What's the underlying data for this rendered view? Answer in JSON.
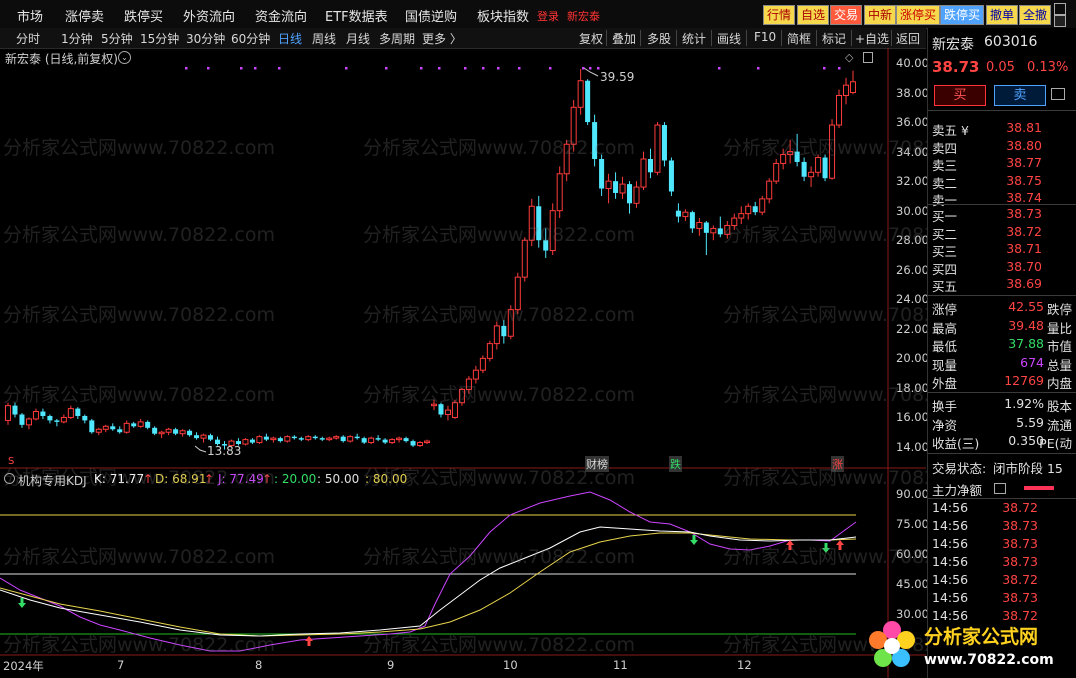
{
  "menu": {
    "items": [
      "市场",
      "涨停卖",
      "跌停买",
      "外资流向",
      "资金流向",
      "ETF数据表",
      "国债逆购",
      "板块指数"
    ],
    "red_items": [
      "登录",
      "新宏泰"
    ],
    "buttons": [
      "行情",
      "自选",
      "交易",
      "中新",
      "涨停买",
      "跌停买",
      "撤单",
      "全撤"
    ],
    "win_icons": [
      "restore-icon",
      "close-icon"
    ]
  },
  "periods": [
    "分时",
    "1分钟",
    "5分钟",
    "15分钟",
    "30分钟",
    "60分钟",
    "日线",
    "周线",
    "月线",
    "多周期",
    "更多 〉"
  ],
  "active_period": "日线",
  "tools": [
    "复权",
    "叠加",
    "多股",
    "统计",
    "画线",
    "F10",
    "简框",
    "标记",
    "+自选",
    "返回"
  ],
  "chart_title": "新宏泰 (日线,前复权)",
  "kdj": {
    "name": "机构专用KDJ",
    "k": "K: 71.77",
    "d": "D: 68.91",
    "j": "J: 77.49",
    "l1": ": 20.00",
    "l2": ": 50.00",
    "l3": ": 80.00",
    "up_arrow": "↑"
  },
  "annotations": {
    "high": "39.59",
    "low": "13.83"
  },
  "event_labels": [
    "S",
    "财榜",
    "跌",
    "涨"
  ],
  "price_axis": [
    "40.00",
    "38.00",
    "36.00",
    "34.00",
    "32.00",
    "30.00",
    "28.00",
    "26.00",
    "24.00",
    "22.00",
    "20.00",
    "18.00",
    "16.00",
    "14.00"
  ],
  "kdj_axis": [
    "90.00",
    "75.00",
    "60.00",
    "45.00",
    "30.00"
  ],
  "x_axis": [
    "2024年",
    "7",
    "8",
    "9",
    "10",
    "11",
    "12"
  ],
  "colors": {
    "up": "#ff3b3b",
    "down": "#4fe8ff",
    "k": "#ffffff",
    "d": "#e8d44d",
    "j": "#cc44ff",
    "line20": "#22bb22",
    "line50": "#e0e0e0",
    "line80": "#e8d44d"
  },
  "quote": {
    "name": "新宏泰",
    "code": "603016",
    "price": "38.73",
    "change": "0.05",
    "pct": "0.13%",
    "buy_btn": "买",
    "sell_btn": "卖",
    "ask": [
      {
        "label": "卖五 ¥",
        "price": "38.81"
      },
      {
        "label": "卖四",
        "price": "38.80"
      },
      {
        "label": "卖三",
        "price": "38.77"
      },
      {
        "label": "卖二",
        "price": "38.75"
      },
      {
        "label": "卖一",
        "price": "38.74"
      }
    ],
    "bid": [
      {
        "label": "买一",
        "price": "38.73"
      },
      {
        "label": "买二",
        "price": "38.72"
      },
      {
        "label": "买三",
        "price": "38.71"
      },
      {
        "label": "买四",
        "price": "38.70"
      },
      {
        "label": "买五",
        "price": "38.69"
      }
    ],
    "stats": [
      {
        "label": "涨停",
        "value": "42.55",
        "extra": "跌停",
        "color": "red"
      },
      {
        "label": "最高",
        "value": "39.48",
        "extra": "量比",
        "color": "red"
      },
      {
        "label": "最低",
        "value": "37.88",
        "extra": "市值",
        "color": "green"
      },
      {
        "label": "现量",
        "value": "674",
        "extra": "总量",
        "color": "mag"
      },
      {
        "label": "外盘",
        "value": "12769",
        "extra": "内盘",
        "color": "red"
      }
    ],
    "stats2": [
      {
        "label": "换手",
        "value": "1.92%",
        "extra": "股本"
      },
      {
        "label": "净资",
        "value": "5.59",
        "extra": "流通"
      },
      {
        "label": "收益(三)",
        "value": "0.350",
        "extra": "PE(动"
      }
    ],
    "trade_status_label": "交易状态:",
    "trade_status": "闭市阶段 15",
    "main_flow": "主力净额",
    "ticks": [
      {
        "t": "14:56",
        "p": "38.72"
      },
      {
        "t": "14:56",
        "p": "38.73"
      },
      {
        "t": "14:56",
        "p": "38.73"
      },
      {
        "t": "14:56",
        "p": "38.73"
      },
      {
        "t": "14:56",
        "p": "38.72"
      },
      {
        "t": "14:56",
        "p": "38.73"
      },
      {
        "t": "14:56",
        "p": "38.72"
      }
    ]
  },
  "logo": {
    "title": "分析家公式网",
    "url": "www.70822.com"
  },
  "watermark": "分析家公式网www.70822.com",
  "chart_data": {
    "type": "candlestick",
    "title": "新宏泰 (日线,前复权)",
    "ylim": [
      13,
      40.5
    ],
    "y_ticks": [
      14,
      16,
      18,
      20,
      22,
      24,
      26,
      28,
      30,
      32,
      34,
      36,
      38,
      40
    ],
    "x_ticks": [
      "2024年",
      "7",
      "8",
      "9",
      "10",
      "11",
      "12"
    ],
    "candles": [
      [
        15.8,
        17.0,
        15.5,
        16.8
      ],
      [
        16.8,
        17.0,
        16.0,
        16.2
      ],
      [
        16.2,
        16.3,
        15.3,
        15.5
      ],
      [
        15.5,
        16.0,
        15.2,
        15.9
      ],
      [
        15.9,
        16.6,
        15.8,
        16.4
      ],
      [
        16.4,
        16.6,
        15.9,
        16.1
      ],
      [
        16.1,
        16.2,
        15.6,
        15.8
      ],
      [
        15.8,
        15.9,
        15.4,
        15.7
      ],
      [
        15.7,
        16.2,
        15.6,
        16.0
      ],
      [
        16.0,
        16.8,
        15.9,
        16.6
      ],
      [
        16.6,
        16.7,
        15.9,
        16.1
      ],
      [
        16.1,
        16.2,
        15.6,
        15.8
      ],
      [
        15.8,
        15.9,
        14.9,
        15.0
      ],
      [
        15.0,
        15.3,
        14.8,
        15.2
      ],
      [
        15.2,
        15.5,
        15.0,
        15.4
      ],
      [
        15.4,
        15.6,
        15.1,
        15.2
      ],
      [
        15.2,
        15.4,
        14.9,
        15.0
      ],
      [
        15.0,
        15.8,
        14.9,
        15.6
      ],
      [
        15.6,
        15.7,
        15.3,
        15.4
      ],
      [
        15.4,
        15.9,
        15.3,
        15.7
      ],
      [
        15.7,
        15.8,
        15.2,
        15.3
      ],
      [
        15.3,
        15.4,
        14.8,
        14.9
      ],
      [
        14.9,
        15.1,
        14.6,
        15.0
      ],
      [
        15.0,
        15.3,
        14.8,
        15.2
      ],
      [
        15.2,
        15.3,
        14.8,
        14.9
      ],
      [
        14.9,
        15.2,
        14.7,
        15.1
      ],
      [
        15.1,
        15.2,
        14.7,
        14.8
      ],
      [
        14.8,
        15.0,
        14.5,
        14.6
      ],
      [
        14.6,
        14.9,
        14.3,
        14.8
      ],
      [
        14.8,
        14.9,
        14.4,
        14.5
      ],
      [
        14.5,
        14.7,
        14.1,
        14.2
      ],
      [
        14.2,
        14.4,
        13.83,
        14.1
      ],
      [
        14.1,
        14.5,
        14.0,
        14.4
      ],
      [
        14.4,
        14.6,
        14.1,
        14.2
      ],
      [
        14.2,
        14.6,
        14.1,
        14.5
      ],
      [
        14.5,
        14.6,
        14.2,
        14.3
      ],
      [
        14.3,
        14.8,
        14.2,
        14.7
      ],
      [
        14.7,
        14.9,
        14.4,
        14.5
      ],
      [
        14.5,
        14.7,
        14.3,
        14.6
      ],
      [
        14.6,
        14.7,
        14.3,
        14.4
      ],
      [
        14.4,
        14.8,
        14.3,
        14.7
      ],
      [
        14.7,
        14.8,
        14.5,
        14.6
      ],
      [
        14.6,
        14.7,
        14.4,
        14.5
      ],
      [
        14.5,
        14.8,
        14.4,
        14.7
      ],
      [
        14.7,
        14.8,
        14.5,
        14.6
      ],
      [
        14.6,
        14.7,
        14.4,
        14.5
      ],
      [
        14.5,
        14.7,
        14.4,
        14.6
      ],
      [
        14.6,
        14.8,
        14.5,
        14.7
      ],
      [
        14.7,
        14.8,
        14.3,
        14.4
      ],
      [
        14.4,
        14.8,
        14.3,
        14.7
      ],
      [
        14.7,
        14.9,
        14.5,
        14.6
      ],
      [
        14.6,
        14.7,
        14.2,
        14.3
      ],
      [
        14.3,
        14.7,
        14.2,
        14.6
      ],
      [
        14.6,
        14.8,
        14.4,
        14.5
      ],
      [
        14.5,
        14.6,
        14.2,
        14.3
      ],
      [
        14.3,
        14.6,
        14.2,
        14.5
      ],
      [
        14.5,
        14.7,
        14.3,
        14.6
      ],
      [
        14.6,
        14.7,
        14.3,
        14.4
      ],
      [
        14.4,
        14.5,
        14.0,
        14.1
      ],
      [
        14.1,
        14.4,
        14.0,
        14.3
      ],
      [
        14.3,
        14.5,
        14.2,
        14.4
      ],
      [
        16.8,
        17.2,
        16.5,
        16.9
      ],
      [
        16.9,
        17.0,
        16.0,
        16.2
      ],
      [
        16.2,
        16.8,
        15.8,
        16.5
      ],
      [
        16.0,
        17.2,
        15.9,
        17.0
      ],
      [
        17.0,
        18.0,
        16.8,
        17.9
      ],
      [
        17.9,
        18.8,
        17.6,
        18.6
      ],
      [
        18.6,
        19.5,
        18.3,
        19.2
      ],
      [
        19.2,
        20.2,
        19.0,
        20.0
      ],
      [
        20.0,
        21.2,
        19.8,
        21.0
      ],
      [
        21.0,
        22.5,
        20.6,
        22.2
      ],
      [
        22.2,
        22.6,
        21.0,
        21.5
      ],
      [
        21.5,
        23.6,
        21.3,
        23.3
      ],
      [
        23.3,
        25.8,
        23.0,
        25.5
      ],
      [
        25.5,
        28.2,
        25.2,
        28.0
      ],
      [
        28.0,
        30.8,
        27.6,
        30.3
      ],
      [
        30.3,
        31.0,
        27.5,
        28.0
      ],
      [
        28.0,
        28.8,
        26.8,
        27.3
      ],
      [
        27.3,
        30.5,
        27.0,
        30.0
      ],
      [
        30.0,
        33.0,
        29.5,
        32.5
      ],
      [
        32.5,
        34.8,
        32.0,
        34.5
      ],
      [
        34.5,
        37.5,
        34.0,
        37.0
      ],
      [
        37.0,
        39.59,
        36.5,
        38.8
      ],
      [
        38.8,
        38.9,
        35.8,
        36.0
      ],
      [
        36.0,
        36.5,
        33.0,
        33.5
      ],
      [
        33.5,
        33.8,
        31.0,
        31.5
      ],
      [
        31.5,
        32.5,
        30.5,
        32.0
      ],
      [
        32.0,
        32.6,
        30.8,
        31.2
      ],
      [
        31.2,
        32.3,
        30.8,
        31.8
      ],
      [
        31.8,
        32.0,
        29.8,
        30.5
      ],
      [
        30.5,
        32.0,
        30.2,
        31.6
      ],
      [
        31.6,
        34.0,
        31.4,
        33.5
      ],
      [
        33.5,
        34.2,
        32.2,
        32.6
      ],
      [
        32.6,
        36.0,
        32.4,
        35.8
      ],
      [
        35.8,
        36.0,
        33.0,
        33.4
      ],
      [
        33.4,
        33.6,
        31.0,
        31.3
      ],
      [
        30.0,
        30.5,
        29.2,
        29.6
      ],
      [
        29.6,
        30.1,
        29.3,
        29.9
      ],
      [
        29.9,
        30.0,
        28.5,
        28.8
      ],
      [
        28.8,
        29.5,
        28.3,
        29.2
      ],
      [
        29.2,
        29.3,
        27.0,
        28.5
      ],
      [
        28.5,
        29.0,
        28.0,
        28.8
      ],
      [
        28.8,
        29.6,
        28.2,
        28.4
      ],
      [
        28.4,
        29.3,
        28.1,
        29.0
      ],
      [
        29.0,
        29.8,
        28.7,
        29.5
      ],
      [
        29.5,
        30.3,
        29.1,
        29.8
      ],
      [
        29.8,
        30.5,
        29.4,
        30.3
      ],
      [
        30.3,
        30.6,
        29.7,
        29.9
      ],
      [
        29.9,
        31.0,
        29.7,
        30.8
      ],
      [
        30.8,
        32.2,
        30.5,
        32.0
      ],
      [
        32.0,
        33.5,
        31.8,
        33.2
      ],
      [
        33.2,
        34.2,
        32.8,
        33.8
      ],
      [
        33.8,
        34.8,
        33.2,
        34.0
      ],
      [
        34.0,
        35.2,
        33.0,
        33.3
      ],
      [
        33.3,
        33.6,
        32.0,
        32.3
      ],
      [
        32.3,
        33.0,
        31.6,
        32.6
      ],
      [
        32.6,
        33.8,
        32.3,
        33.6
      ],
      [
        33.6,
        33.8,
        32.0,
        32.2
      ],
      [
        32.2,
        36.2,
        32.1,
        35.8
      ],
      [
        35.8,
        38.2,
        35.6,
        37.8
      ],
      [
        37.8,
        39.0,
        37.2,
        38.5
      ],
      [
        38.0,
        39.48,
        37.88,
        38.73
      ]
    ]
  }
}
